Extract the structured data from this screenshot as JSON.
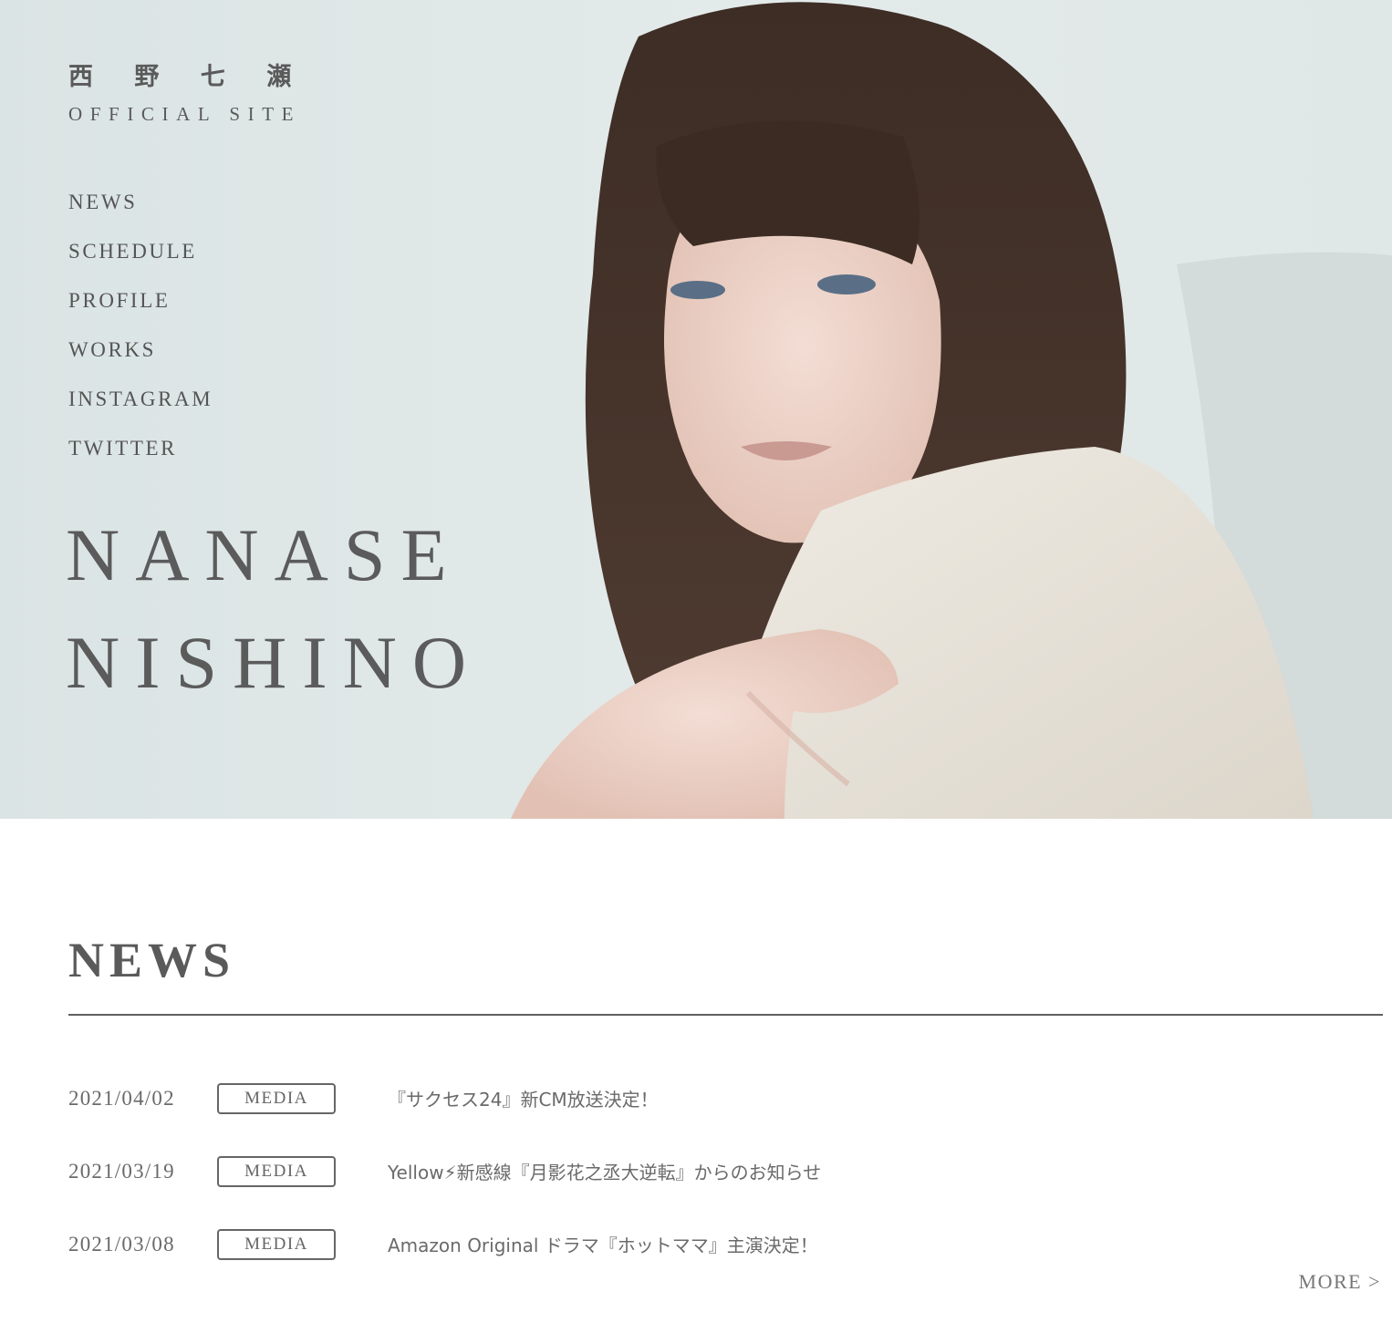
{
  "header": {
    "brand_jp": "西 野 七 瀬",
    "brand_en": "OFFICIAL SITE"
  },
  "nav": {
    "items": [
      {
        "label": "NEWS"
      },
      {
        "label": "SCHEDULE"
      },
      {
        "label": "PROFILE"
      },
      {
        "label": "WORKS"
      },
      {
        "label": "INSTAGRAM"
      },
      {
        "label": "TWITTER"
      }
    ]
  },
  "hero": {
    "name_line1": "NANASE",
    "name_line2": "NISHINO"
  },
  "news": {
    "title": "NEWS",
    "items": [
      {
        "date": "2021/04/02",
        "tag": "MEDIA",
        "text": "『サクセス24』新CM放送決定！"
      },
      {
        "date": "2021/03/19",
        "tag": "MEDIA",
        "text": "Yellow⚡新感線『月影花之丞大逆転』からのお知らせ"
      },
      {
        "date": "2021/03/08",
        "tag": "MEDIA",
        "text": "Amazon Original ドラマ『ホットママ』主演決定！"
      }
    ],
    "more_label": "MORE >"
  },
  "colors": {
    "text": "#5f5f5f",
    "hero_bg": "#dde6e6"
  }
}
